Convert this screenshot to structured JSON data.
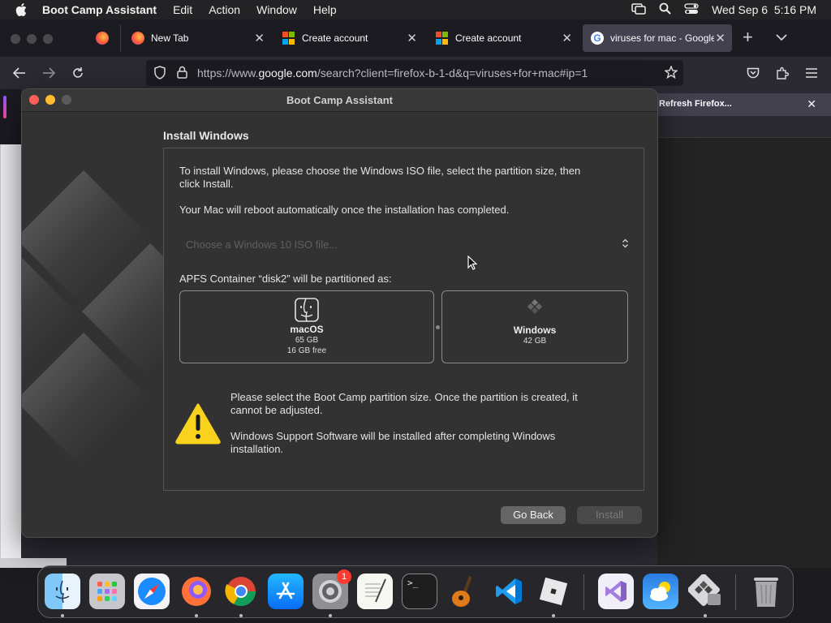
{
  "menubar": {
    "app_name": "Boot Camp Assistant",
    "menus": [
      "Edit",
      "Action",
      "Window",
      "Help"
    ],
    "datetime": "Wed Sep 6  5:16 PM"
  },
  "firefox": {
    "tabs": [
      {
        "title": "New Tab"
      },
      {
        "title": "Create account"
      },
      {
        "title": "Create account"
      },
      {
        "title": "viruses for mac - Google"
      }
    ],
    "url": {
      "prefix": "https://www.",
      "domain": "google.com",
      "rest": "/search?client=firefox-b-1-d&q=viruses+for+mac#ip=1"
    },
    "notification": "Refresh Firefox..."
  },
  "dialog": {
    "title": "Boot Camp Assistant",
    "section_title": "Install Windows",
    "intro_line1": "To install Windows, please choose the Windows ISO file, select the partition size, then",
    "intro_line2": "click Install.",
    "reboot_note": "Your Mac will reboot automatically once the installation has completed.",
    "iso_placeholder": "Choose a Windows 10 ISO file...",
    "partition_label": "APFS Container “disk2” will be partitioned as:",
    "partitions": {
      "macos": {
        "name": "macOS",
        "size": "65 GB",
        "free": "16 GB free"
      },
      "windows": {
        "name": "Windows",
        "size": "42 GB"
      }
    },
    "warning_line1": "Please select the Boot Camp partition size. Once the partition is created, it",
    "warning_line2": "cannot be adjusted.",
    "support_line1": "Windows Support Software will be installed after completing Windows",
    "support_line2": "installation.",
    "go_back": "Go Back",
    "install": "Install"
  },
  "dock": {
    "settings_badge": "1",
    "apps": [
      "finder-icon",
      "launchpad-icon",
      "safari-icon",
      "firefox-icon",
      "chrome-icon",
      "app-store-icon",
      "system-settings-icon",
      "textedit-icon",
      "terminal-icon",
      "garageband-icon",
      "vscode-icon",
      "roblox-icon",
      "visual-studio-icon",
      "weather-icon",
      "boot-camp-icon",
      "trash-icon"
    ]
  },
  "colors": {
    "accent_close": "#ff5f57",
    "accent_min": "#febc2e",
    "warning": "#f8d21c"
  }
}
